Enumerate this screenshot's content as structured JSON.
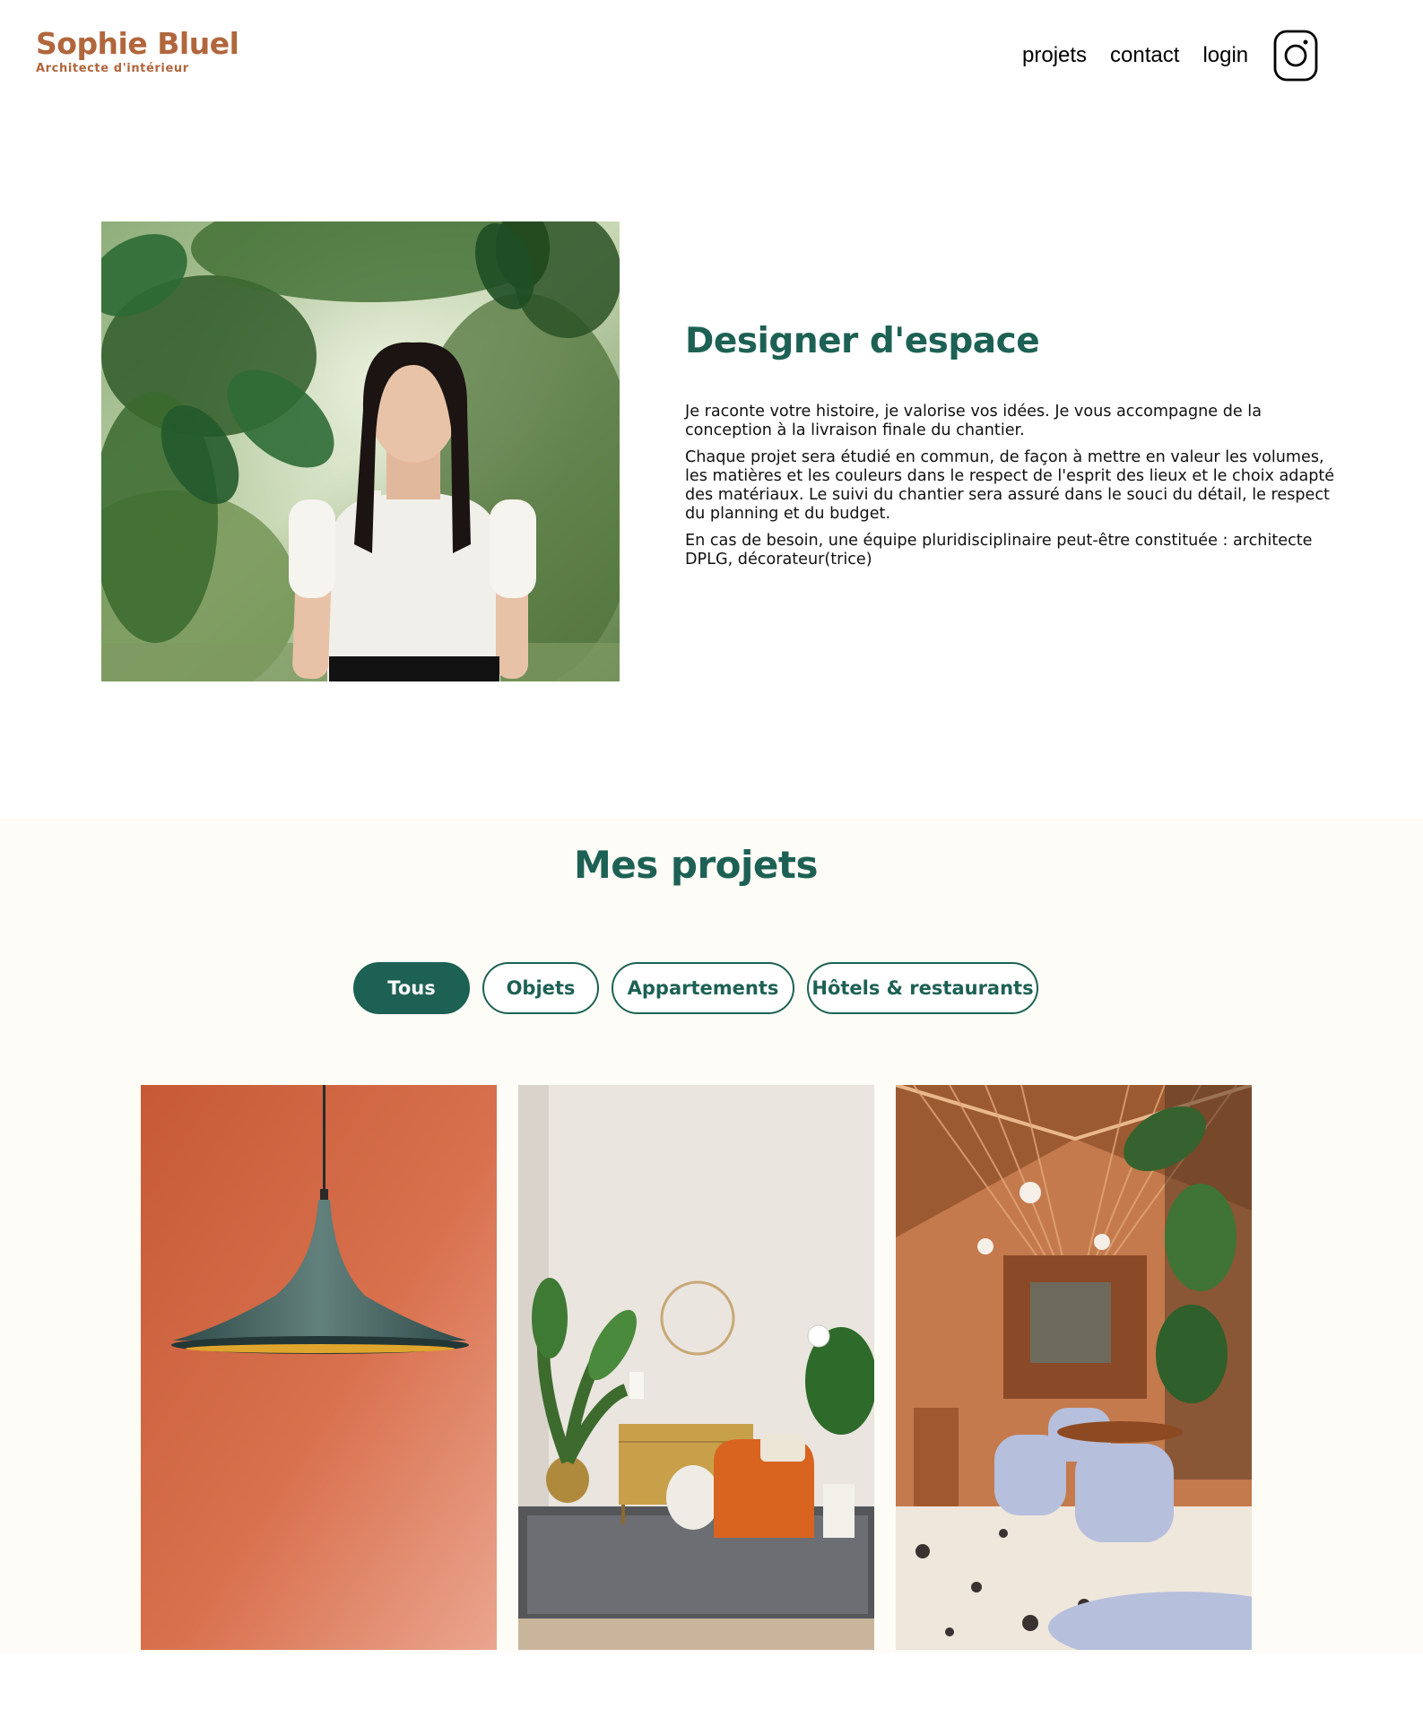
{
  "colors": {
    "brand": "#b1663c",
    "primary": "#1d6154",
    "section_bg": "#fefcf6",
    "text": "#1e1e1e"
  },
  "header": {
    "logo_title": "Sophie Bluel",
    "logo_subtitle": "Architecte d'intérieur",
    "nav": [
      "projets",
      "contact",
      "login"
    ],
    "social_icon": "instagram-icon"
  },
  "intro": {
    "title": "Designer d'espace",
    "paragraphs": [
      "Je raconte votre histoire, je valorise vos idées. Je vous accompagne de la conception à la livraison finale du chantier.",
      "Chaque projet sera étudié en commun, de façon à mettre en valeur les volumes, les matières et les couleurs dans le respect de l'esprit des lieux et le choix adapté des matériaux. Le suivi du chantier sera assuré dans le souci du détail, le respect du planning et du budget.",
      "En cas de besoin, une équipe pluridisciplinaire peut-être constituée : architecte DPLG, décorateur(trice)"
    ]
  },
  "portfolio": {
    "title": "Mes projets",
    "filters": [
      "Tous",
      "Objets",
      "Appartements",
      "Hôtels & restaurants"
    ],
    "active_filter": "Tous"
  }
}
